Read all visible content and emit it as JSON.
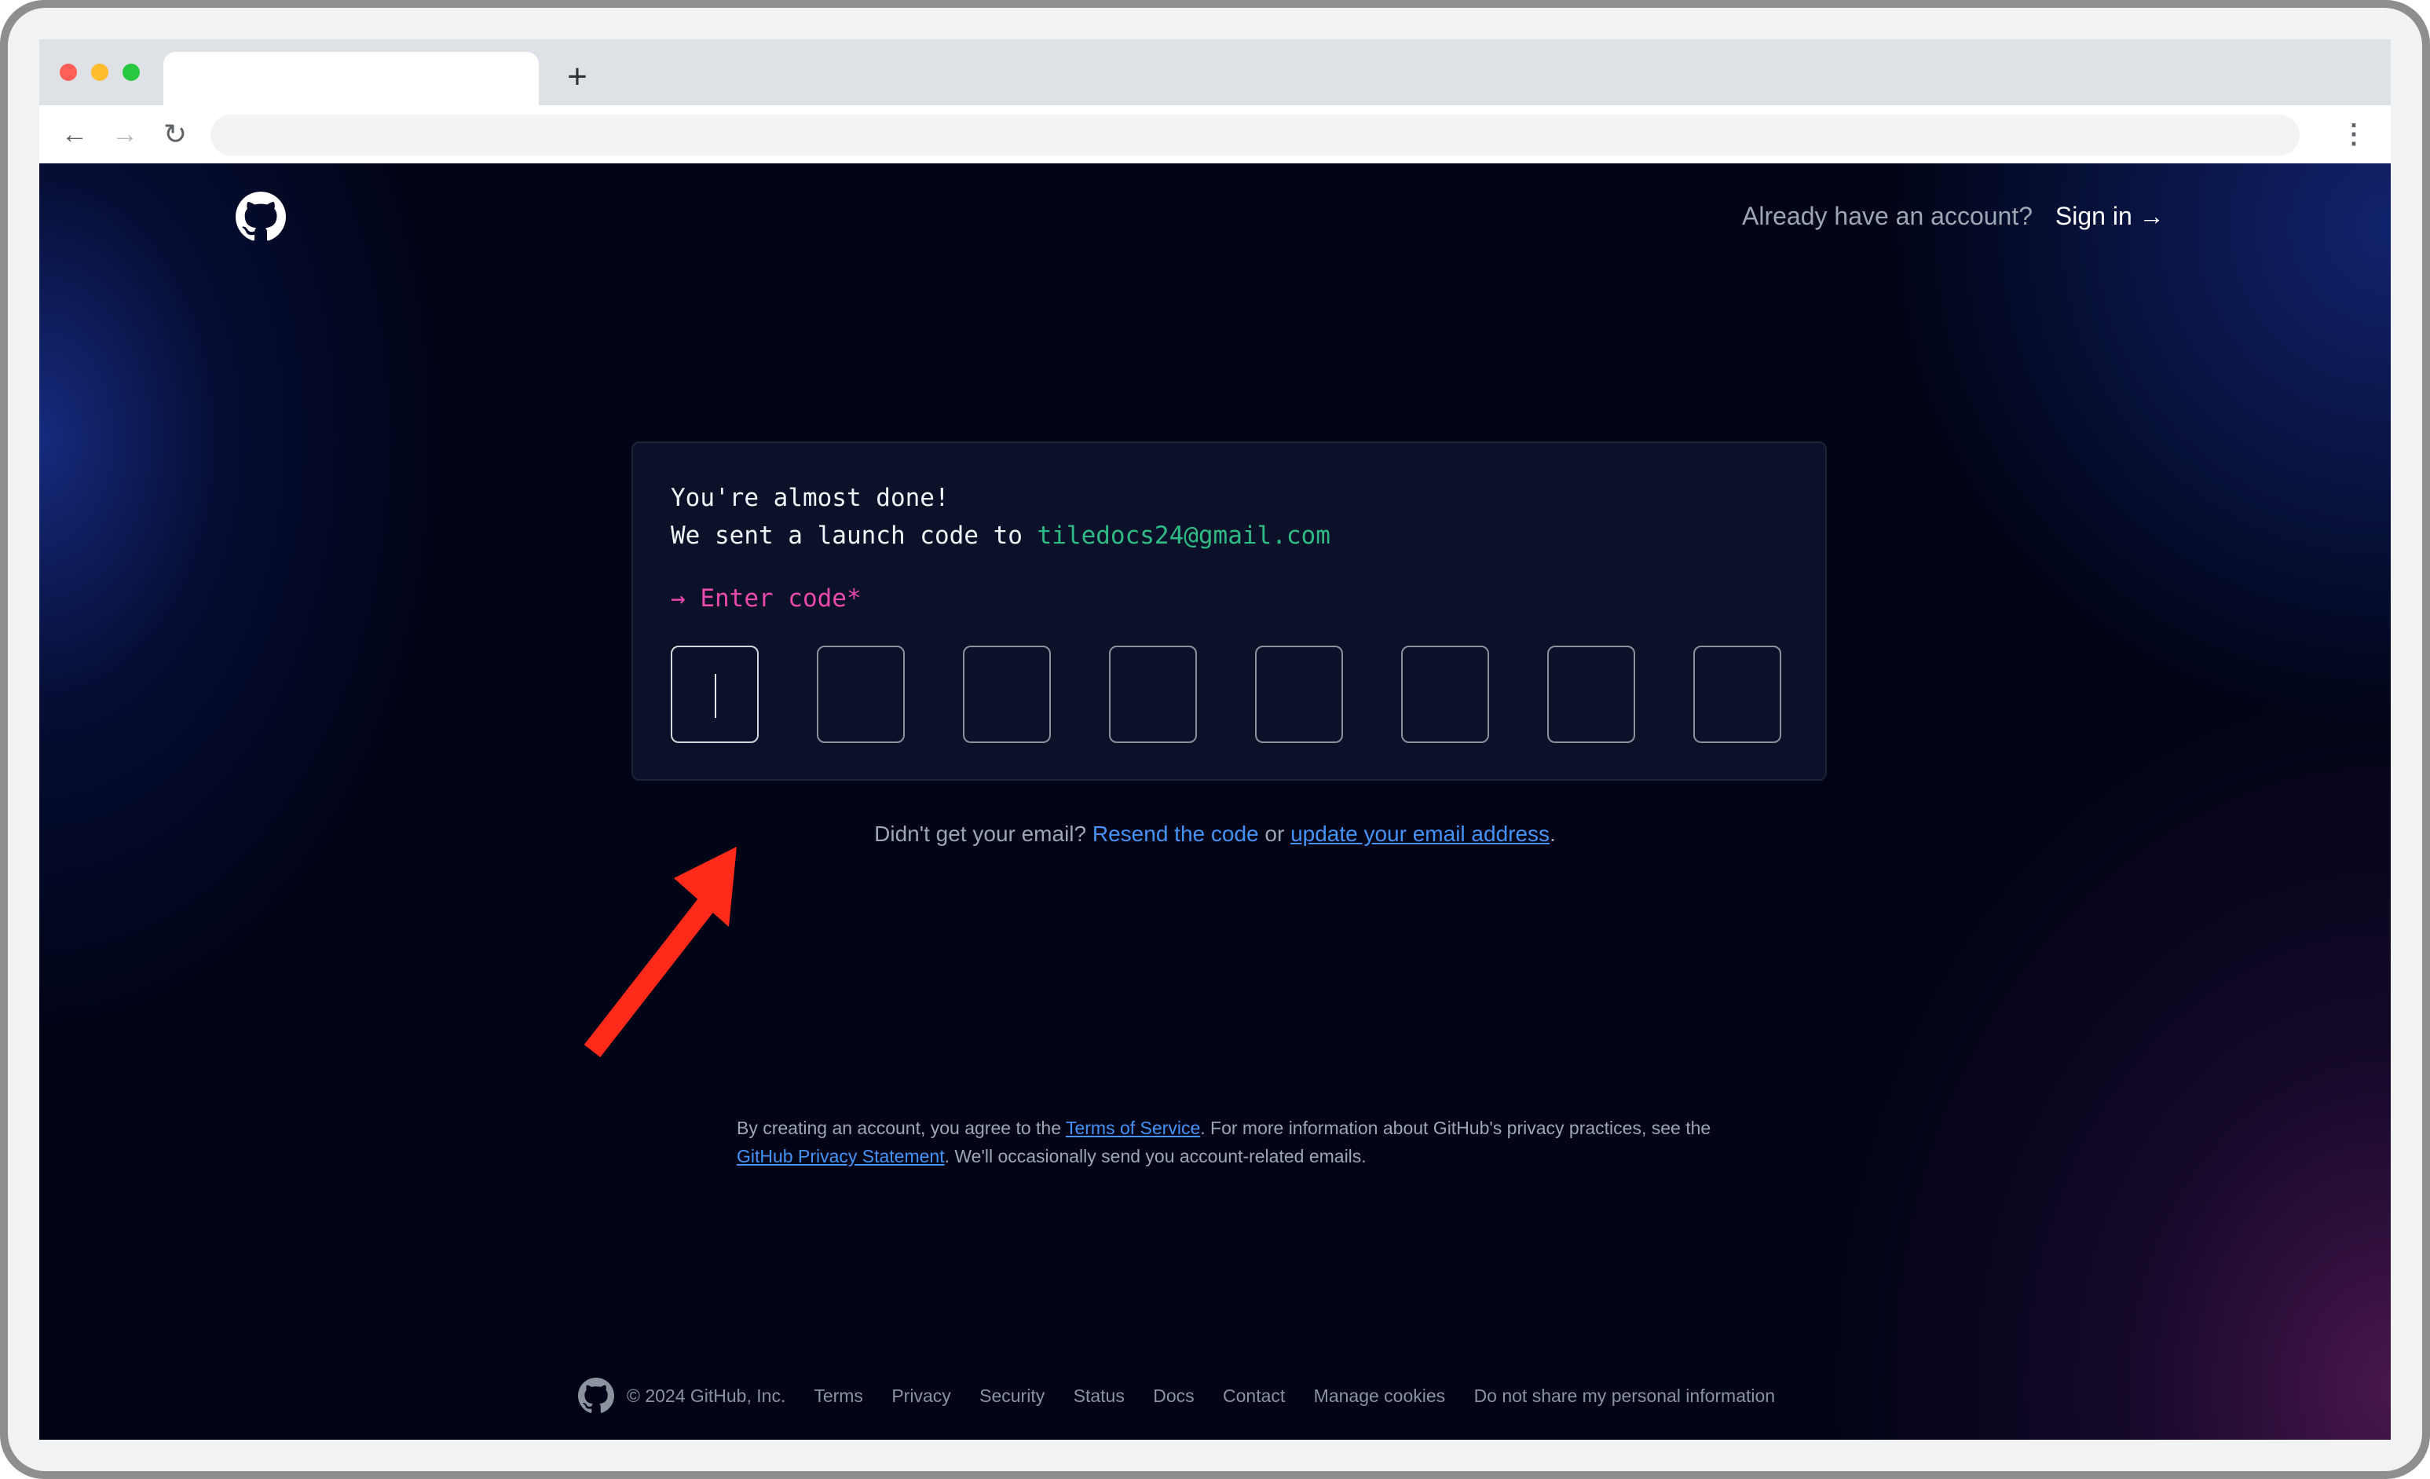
{
  "browser": {
    "new_tab_glyph": "+",
    "nav": {
      "back_glyph": "←",
      "forward_glyph": "→",
      "reload_glyph": "↻",
      "menu_glyph": "⋮"
    }
  },
  "header": {
    "already_text": "Already have an account?",
    "signin_label": "Sign in →"
  },
  "verify": {
    "line1": "You're almost done!",
    "line2_prefix": "We sent a launch code to ",
    "email": "tiledocs24@gmail.com",
    "enter_label": "→ Enter code*",
    "code_box_count": 8
  },
  "help": {
    "prefix": "Didn't get your email? ",
    "resend_label": "Resend the code",
    "or_text": " or ",
    "update_label": "update your email address",
    "suffix": "."
  },
  "legal": {
    "part1": "By creating an account, you agree to the ",
    "terms_label": "Terms of Service",
    "part2": ". For more information about GitHub's privacy practices, see the ",
    "privacy_label": "GitHub Privacy Statement",
    "part3": ". We'll occasionally send you account-related emails."
  },
  "footer": {
    "copyright": "© 2024 GitHub, Inc.",
    "links": [
      "Terms",
      "Privacy",
      "Security",
      "Status",
      "Docs",
      "Contact",
      "Manage cookies",
      "Do not share my personal information"
    ]
  },
  "colors": {
    "page_bg": "#010416",
    "card_bg": "#0b1128",
    "email_green": "#2fbb85",
    "label_pink": "#ea4aaa",
    "link_blue": "#4493f8",
    "annotation_arrow": "#ff2a1a"
  },
  "icons": {
    "logo": "github-logo-icon",
    "annotation": "red-arrow-icon"
  }
}
